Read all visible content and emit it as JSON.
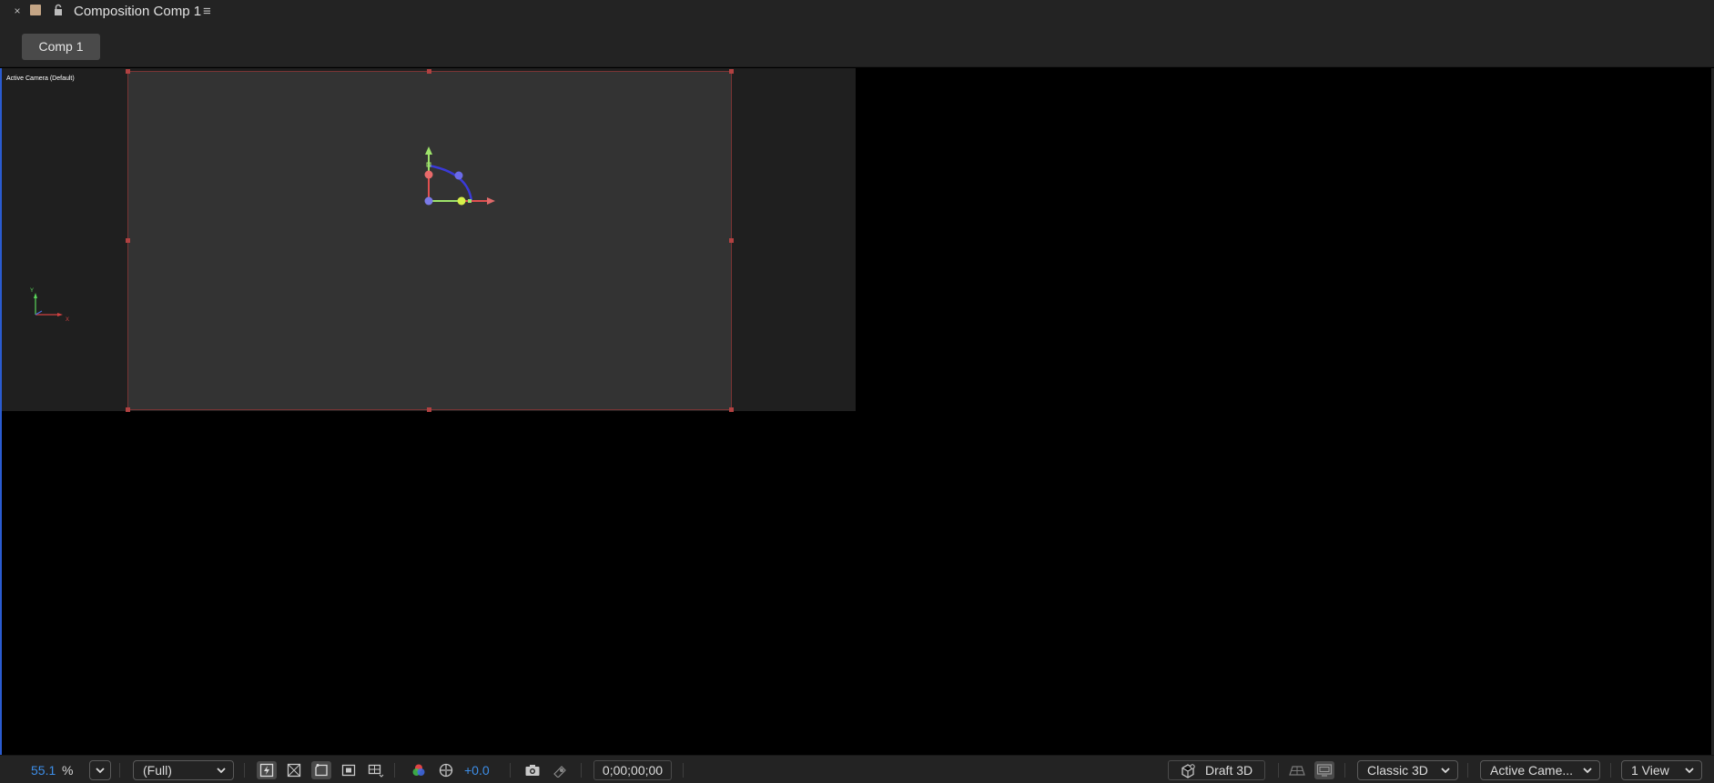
{
  "panel": {
    "title": "Composition Comp 1",
    "close_glyph": "×",
    "menu_glyph": "≡",
    "label_color": "#c4a585"
  },
  "tabs": [
    {
      "label": "Comp 1"
    }
  ],
  "viewer": {
    "camera_label": "Active Camera (Default)",
    "axis_x": "X",
    "axis_y": "Y",
    "background": "#333333"
  },
  "toolbar": {
    "zoom_value": "55.1",
    "zoom_unit": "%",
    "resolution": "(Full)",
    "exposure": "+0.0",
    "timecode": "0;00;00;00",
    "renderer_button": "Draft 3D",
    "renderer": "Classic 3D",
    "view": "Active Came...",
    "layout": "1 View"
  },
  "colors": {
    "accent_blue": "#3d8ee8",
    "gizmo_x": "#e05050",
    "gizmo_y": "#9ee36a",
    "gizmo_z": "#6a6ae8"
  }
}
